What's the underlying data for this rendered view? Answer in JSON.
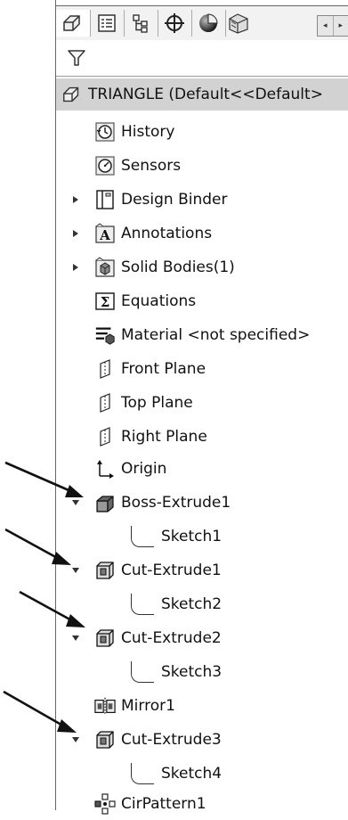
{
  "toolbar": {
    "tabs": [
      "feature-manager-icon",
      "property-manager-icon",
      "configuration-manager-icon",
      "dimxpert-icon",
      "display-manager-icon",
      "cam-icon"
    ],
    "scroll": [
      "◂",
      "▸"
    ]
  },
  "tree": {
    "root": "TRIANGLE  (Default<<Default>",
    "items": [
      {
        "label": "History",
        "icon": "history-icon",
        "expandable": false
      },
      {
        "label": "Sensors",
        "icon": "sensors-icon",
        "expandable": false
      },
      {
        "label": "Design Binder",
        "icon": "design-binder-icon",
        "expandable": true
      },
      {
        "label": "Annotations",
        "icon": "annotations-icon",
        "expandable": true
      },
      {
        "label": "Solid Bodies(1)",
        "icon": "solid-bodies-icon",
        "expandable": true
      },
      {
        "label": "Equations",
        "icon": "equations-icon",
        "expandable": false
      },
      {
        "label": "Material <not specified>",
        "icon": "material-icon",
        "expandable": false
      },
      {
        "label": "Front Plane",
        "icon": "plane-icon",
        "expandable": false
      },
      {
        "label": "Top Plane",
        "icon": "plane-icon",
        "expandable": false
      },
      {
        "label": "Right Plane",
        "icon": "plane-icon",
        "expandable": false
      },
      {
        "label": "Origin",
        "icon": "origin-icon",
        "expandable": false
      },
      {
        "label": "Boss-Extrude1",
        "icon": "boss-extrude-icon",
        "expandable": true,
        "expanded": true
      },
      {
        "label": "Sketch1",
        "icon": "sketch-icon",
        "child": true
      },
      {
        "label": "Cut-Extrude1",
        "icon": "cut-extrude-icon",
        "expandable": true,
        "expanded": true
      },
      {
        "label": "Sketch2",
        "icon": "sketch-icon",
        "child": true
      },
      {
        "label": "Cut-Extrude2",
        "icon": "cut-extrude-icon",
        "expandable": true,
        "expanded": true
      },
      {
        "label": "Sketch3",
        "icon": "sketch-icon",
        "child": true
      },
      {
        "label": "Mirror1",
        "icon": "mirror-icon",
        "expandable": false
      },
      {
        "label": "Cut-Extrude3",
        "icon": "cut-extrude-icon",
        "expandable": true,
        "expanded": true
      },
      {
        "label": "Sketch4",
        "icon": "sketch-icon",
        "child": true
      },
      {
        "label": "CirPattern1",
        "icon": "circular-pattern-icon",
        "expandable": false
      }
    ]
  },
  "colors": {
    "root_highlight": "#d2d2d2",
    "panel_border": "#666666",
    "arrow": "#111111"
  }
}
